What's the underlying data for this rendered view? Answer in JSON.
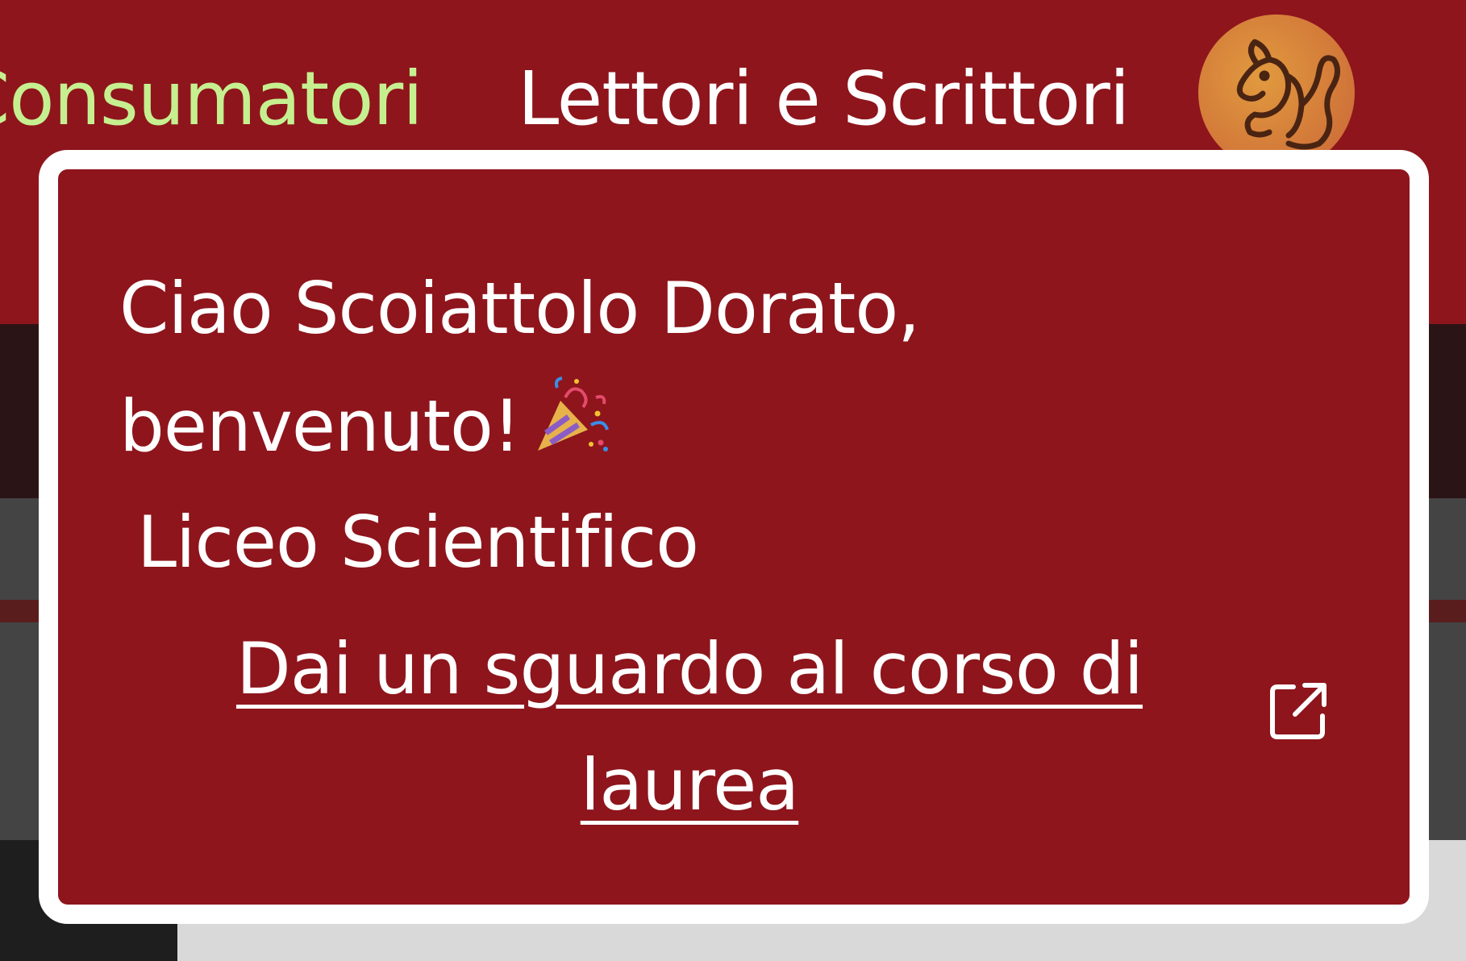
{
  "topbar": {
    "nav_items": [
      {
        "label": "Consumatori",
        "active": true
      },
      {
        "label": "Lettori e Scrittori",
        "active": false
      }
    ],
    "avatar_icon": "squirrel-icon",
    "background_color": "#8e151c",
    "active_color": "#c6f090"
  },
  "welcome_card": {
    "greeting_line1": "Ciao Scoiattolo Dorato,",
    "greeting_line2": "benvenuto!",
    "greeting_icon": "party-popper-icon",
    "school": "Liceo Scientifico",
    "course_link_label": "Dai un sguardo al corso di laurea",
    "link_icon": "external-link-icon",
    "border_color": "#ffffff"
  }
}
